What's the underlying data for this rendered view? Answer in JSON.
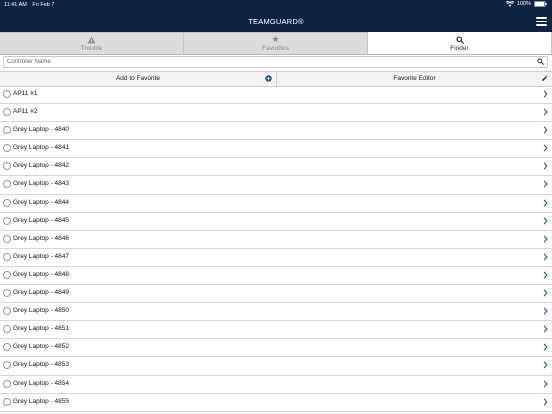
{
  "status_bar": {
    "time": "11:41 AM",
    "date": "Fri Feb 7",
    "battery": "100%"
  },
  "header": {
    "title": "TEAMGUARD®"
  },
  "tabs": [
    {
      "label": "Trouble",
      "icon": "warning-icon",
      "active": false
    },
    {
      "label": "Favorites",
      "icon": "star-icon",
      "active": false
    },
    {
      "label": "Finder",
      "icon": "search-icon",
      "active": true
    }
  ],
  "search": {
    "placeholder": "Controller Name",
    "value": ""
  },
  "actions": {
    "add_favorite": "Add to Favorite",
    "favorite_editor": "Favorite Editor"
  },
  "items": [
    "AP11 #1",
    "AP11 #2",
    "Grey Laptop - 4840",
    "Grey Laptop - 4841",
    "Grey Laptop - 4842",
    "Grey Laptop - 4843",
    "Grey Laptop - 4844",
    "Grey Laptop - 4845",
    "Grey Laptop - 4846",
    "Grey Laptop - 4847",
    "Grey Laptop - 4848",
    "Grey Laptop - 4849",
    "Grey Laptop - 4850",
    "Grey Laptop - 4851",
    "Grey Laptop - 4852",
    "Grey Laptop - 4853",
    "Grey Laptop - 4854",
    "Grey Laptop - 4855"
  ],
  "colors": {
    "header_bg": "#0d2542",
    "accent": "#1f4e8c",
    "tab_inactive_bg": "#dcdcdc"
  }
}
